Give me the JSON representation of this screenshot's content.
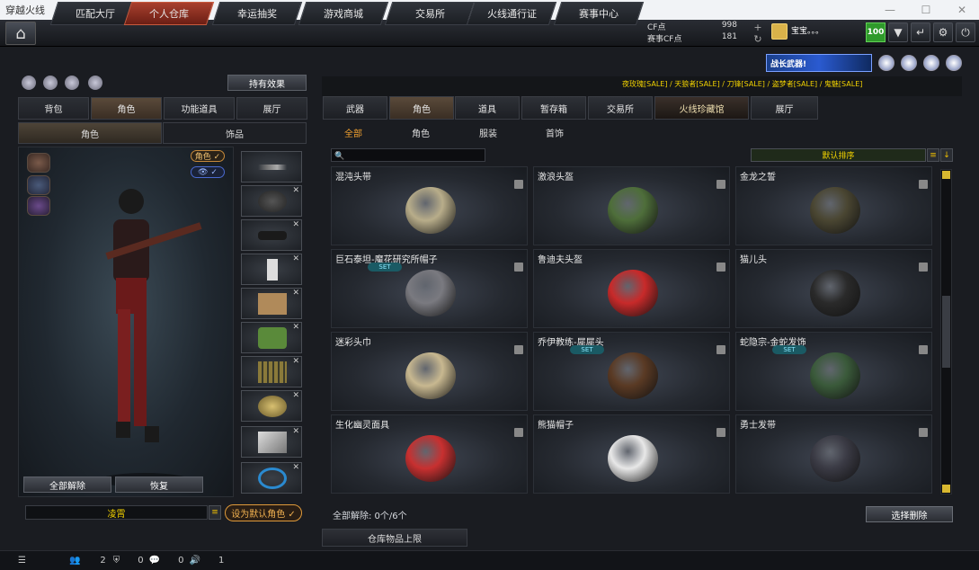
{
  "window": {
    "title": "穿越火线"
  },
  "nav": {
    "tabs": [
      "匹配大厅",
      "个人仓库",
      "幸运抽奖",
      "游戏商城",
      "交易所",
      "火线通行证",
      "赛事中心"
    ],
    "active": "个人仓库"
  },
  "currency": {
    "cf_label": "CF点",
    "cf_value": "998",
    "match_label": "赛事CF点",
    "match_value": "181"
  },
  "user": {
    "name": "宝宝。。。",
    "level": "100"
  },
  "left": {
    "effect_button": "持有效果",
    "tabs": [
      "背包",
      "角色",
      "功能道具",
      "展厅"
    ],
    "active_tab": "角色",
    "subtabs": [
      "角色",
      "饰品"
    ],
    "role_badge": "角色 ✓",
    "eye_badge": "👁 ✓",
    "release_all": "全部解除",
    "restore": "恢复",
    "character_name": "凌霄",
    "set_default": "设为默认角色 ✓"
  },
  "banner": {
    "text": "战长武器!",
    "marquee": "夜玫瑰[SALE] / 天狼者[SALE] / 刀锋[SALE] / 盗梦者[SALE] / 鬼魅[SALE]"
  },
  "right": {
    "tabs": [
      "武器",
      "角色",
      "道具",
      "暂存箱",
      "交易所",
      "火线珍藏馆",
      "展厅"
    ],
    "active_tab": "角色",
    "filters": [
      "全部",
      "角色",
      "服装",
      "首饰"
    ],
    "active_filter": "全部",
    "sort": "默认排序",
    "items": [
      {
        "name": "混沌头带",
        "set": "",
        "color": "#b8ad8a"
      },
      {
        "name": "激浪头盔",
        "set": "",
        "color": "#4e6e3a"
      },
      {
        "name": "金龙之誓",
        "set": "",
        "color": "#4a4632"
      },
      {
        "name": "巨石泰坦-魔花研究所帽子",
        "set": "SET",
        "color": "#7a7a80"
      },
      {
        "name": "鲁迪夫头盔",
        "set": "",
        "color": "#c82a2a"
      },
      {
        "name": "猫儿头",
        "set": "",
        "color": "#2a2a2a"
      },
      {
        "name": "迷彩头巾",
        "set": "",
        "color": "#c8b890"
      },
      {
        "name": "乔伊教练-犀犀头",
        "set": "SET",
        "color": "#5a3a24"
      },
      {
        "name": "蛇隐宗-金蛇发饰",
        "set": "SET",
        "color": "#3a5a3a"
      },
      {
        "name": "生化幽灵面具",
        "set": "",
        "color": "#c83030"
      },
      {
        "name": "熊猫帽子",
        "set": "",
        "color": "#e8e8e8"
      },
      {
        "name": "勇士发带",
        "set": "",
        "color": "#3a3a44"
      }
    ],
    "release_count": "全部解除: 0个/6个",
    "delete_button": "选择删除",
    "storage_limit": "仓库物品上限"
  },
  "status": {
    "v1": "2",
    "v2": "0",
    "v3": "0",
    "v4": "1"
  }
}
